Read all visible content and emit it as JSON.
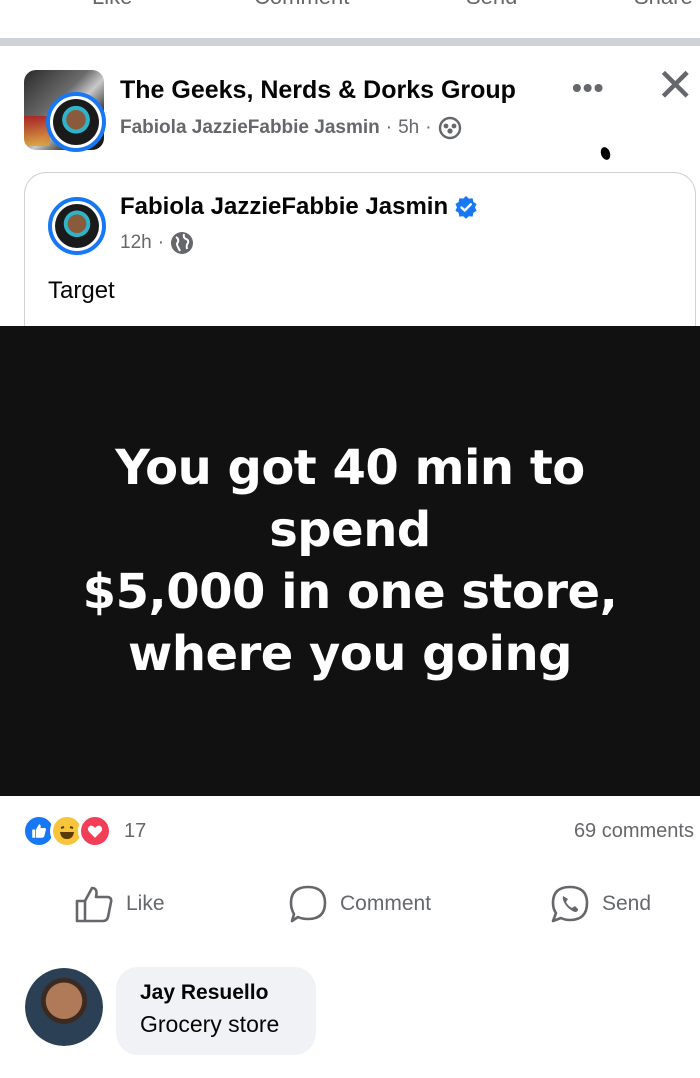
{
  "top_actions": {
    "like": "Like",
    "comment": "Comment",
    "send": "Send",
    "share": "Share"
  },
  "group": {
    "name": "The Geeks, Nerds & Dorks Group",
    "poster": "Fabiola JazzieFabbie Jasmin",
    "time": "5h",
    "sep": "·"
  },
  "shared": {
    "author": "Fabiola JazzieFabbie Jasmin",
    "time": "12h",
    "sep": "·",
    "text": "Target"
  },
  "image_caption_lines": [
    "You got 40 min to spend",
    "$5,000 in one store,",
    "where you going"
  ],
  "reactions": {
    "count": "17",
    "comments": "69 comments"
  },
  "actions": {
    "like": "Like",
    "comment": "Comment",
    "send": "Send"
  },
  "comment": {
    "author": "Jay Resuello",
    "text": "Grocery store"
  },
  "icons": {
    "more": "more-options-icon",
    "close": "close-icon",
    "privacy_group": "group-privacy-icon",
    "privacy_public": "globe-icon",
    "verified": "verified-badge-icon"
  },
  "colors": {
    "accent": "#1877f2",
    "muted": "#65676b",
    "image_bg": "#111111"
  }
}
